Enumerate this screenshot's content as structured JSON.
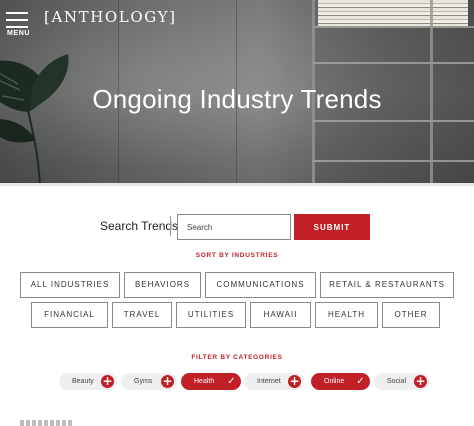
{
  "header": {
    "menu_label": "MENU",
    "logo_text": "[ANTHOLOGY]",
    "hero_title": "Ongoing Industry Trends"
  },
  "search": {
    "label": "Search Trends",
    "placeholder": "Search",
    "value": "",
    "submit_label": "SUBMIT"
  },
  "industries": {
    "heading": "SORT BY INDUSTRIES",
    "row1": [
      "ALL INDUSTRIES",
      "BEHAVIORS",
      "COMMUNICATIONS",
      "RETAIL & RESTAURANTS"
    ],
    "row2": [
      "FINANCIAL",
      "TRAVEL",
      "UTILITIES",
      "HAWAII",
      "HEALTH",
      "OTHER"
    ]
  },
  "categories": {
    "heading": "FILTER BY CATEGORIES",
    "items": [
      {
        "label": "Beauty",
        "active": false,
        "icon": "plus-icon"
      },
      {
        "label": "Gyms",
        "active": false,
        "icon": "plus-icon"
      },
      {
        "label": "Health",
        "active": true,
        "icon": "check-icon"
      },
      {
        "label": "Internet",
        "active": false,
        "icon": "plus-icon"
      },
      {
        "label": "Online",
        "active": true,
        "icon": "check-icon"
      },
      {
        "label": "Social",
        "active": false,
        "icon": "plus-icon"
      }
    ]
  },
  "colors": {
    "accent": "#c02026",
    "chip_background": "#efefef",
    "button_border": "#8a8a8a"
  }
}
